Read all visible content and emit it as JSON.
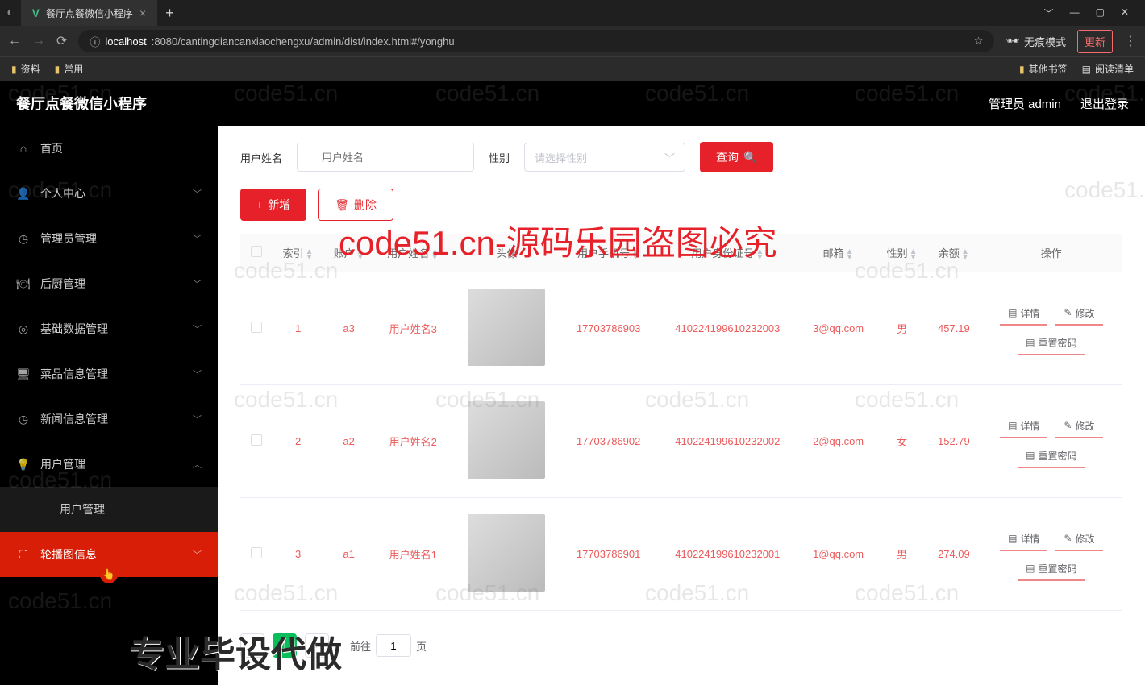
{
  "browser": {
    "tab_title": "餐厅点餐微信小程序",
    "url_prefix": "localhost",
    "url_path": ":8080/cantingdiancanxiaochengxu/admin/dist/index.html#/yonghu",
    "incognito": "无痕模式",
    "update": "更新",
    "bookmarks": {
      "b1": "资料",
      "b2": "常用",
      "r1": "其他书签",
      "r2": "阅读清单"
    }
  },
  "header": {
    "title": "餐厅点餐微信小程序",
    "admin": "管理员 admin",
    "logout": "退出登录"
  },
  "sidebar": {
    "items": [
      {
        "icon": "⌂",
        "label": "首页",
        "expand": ""
      },
      {
        "icon": "👤",
        "label": "个人中心",
        "expand": "﹀"
      },
      {
        "icon": "◷",
        "label": "管理员管理",
        "expand": "﹀"
      },
      {
        "icon": "🍽",
        "label": "后厨管理",
        "expand": "﹀"
      },
      {
        "icon": "◎",
        "label": "基础数据管理",
        "expand": "﹀"
      },
      {
        "icon": "🖥",
        "label": "菜品信息管理",
        "expand": "﹀"
      },
      {
        "icon": "◷",
        "label": "新闻信息管理",
        "expand": "﹀"
      },
      {
        "icon": "💡",
        "label": "用户管理",
        "expand": "︿"
      },
      {
        "icon": "",
        "label": "用户管理",
        "expand": "",
        "sub": true
      },
      {
        "icon": "⛶",
        "label": "轮播图信息",
        "expand": "﹀",
        "active": true
      }
    ]
  },
  "filter": {
    "name_label": "用户姓名",
    "name_placeholder": "用户姓名",
    "gender_label": "性别",
    "gender_placeholder": "请选择性别",
    "search": "查询"
  },
  "actions": {
    "add": "新增",
    "delete": "删除"
  },
  "table": {
    "headers": [
      "索引",
      "账户",
      "用户姓名",
      "头像",
      "用户手机号",
      "用户身份证号",
      "邮箱",
      "性别",
      "余额",
      "操作"
    ],
    "rows": [
      {
        "idx": "1",
        "acct": "a3",
        "name": "用户姓名3",
        "phone": "17703786903",
        "idnum": "410224199610232003",
        "email": "3@qq.com",
        "gender": "男",
        "balance": "457.19"
      },
      {
        "idx": "2",
        "acct": "a2",
        "name": "用户姓名2",
        "phone": "17703786902",
        "idnum": "410224199610232002",
        "email": "2@qq.com",
        "gender": "女",
        "balance": "152.79"
      },
      {
        "idx": "3",
        "acct": "a1",
        "name": "用户姓名1",
        "phone": "17703786901",
        "idnum": "410224199610232001",
        "email": "1@qq.com",
        "gender": "男",
        "balance": "274.09"
      }
    ],
    "op": {
      "detail": "详情",
      "edit": "修改",
      "reset": "重置密码"
    }
  },
  "pager": {
    "current": "1",
    "goto_pre": "前往",
    "goto_page": "1",
    "goto_suf": "页"
  },
  "watermark": {
    "text": "code51.cn",
    "red": "code51.cn-源码乐园盗图必究",
    "banner": "专业毕设代做"
  }
}
